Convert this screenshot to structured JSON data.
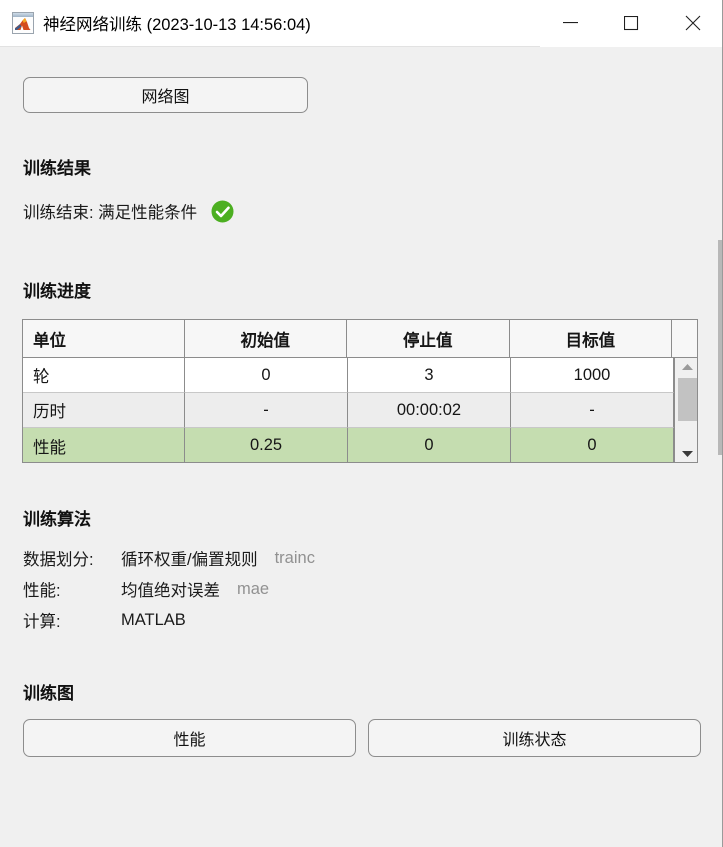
{
  "window": {
    "title": "神经网络训练 (2023-10-13 14:56:04)",
    "icon": "matlab-icon",
    "minimize_label": "—",
    "maximize_label": "□",
    "close_label": "✕"
  },
  "toolbar": {
    "network_diagram_label": "网络图"
  },
  "results": {
    "heading": "训练结果",
    "status_label": "训练结束: 满足性能条件",
    "status_icon": "check-circle-icon",
    "status_color": "#4caf21"
  },
  "progress": {
    "heading": "训练进度",
    "columns": [
      "单位",
      "初始值",
      "停止值",
      "目标值"
    ],
    "rows": [
      {
        "unit": "轮",
        "initial": "0",
        "stop": "3",
        "target": "1000",
        "highlight": false
      },
      {
        "unit": "历时",
        "initial": "-",
        "stop": "00:00:02",
        "target": "-",
        "highlight": false
      },
      {
        "unit": "性能",
        "initial": "0.25",
        "stop": "0",
        "target": "0",
        "highlight": true
      }
    ],
    "highlight_color": "#c5ddb0",
    "scroll_up_icon": "triangle-up-icon",
    "scroll_down_icon": "triangle-down-icon"
  },
  "algorithm": {
    "heading": "训练算法",
    "rows": [
      {
        "label": "数据划分:",
        "value": "循环权重/偏置规则",
        "code": "trainc"
      },
      {
        "label": "性能:",
        "value": "均值绝对误差",
        "code": "mae"
      },
      {
        "label": "计算:",
        "value": "MATLAB",
        "code": ""
      }
    ]
  },
  "plots": {
    "heading": "训练图",
    "performance_label": "性能",
    "state_label": "训练状态"
  }
}
